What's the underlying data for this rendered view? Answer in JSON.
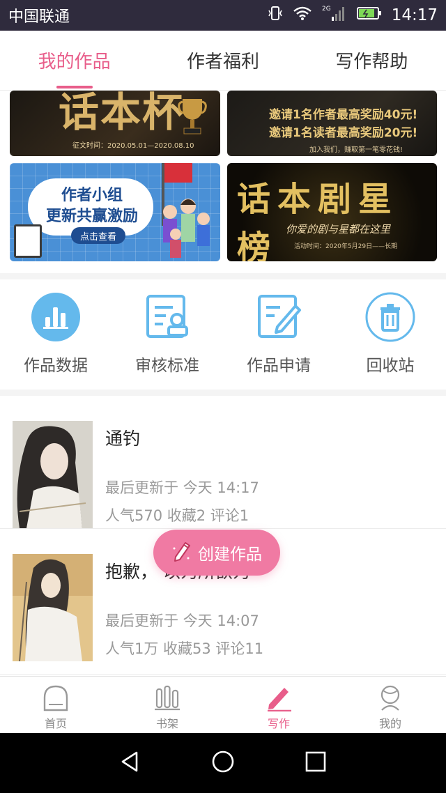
{
  "status_bar": {
    "carrier": "中国联通",
    "network": "2G",
    "time": "14:17"
  },
  "top_tabs": [
    {
      "label": "我的作品",
      "active": true
    },
    {
      "label": "作者福利",
      "active": false
    },
    {
      "label": "写作帮助",
      "active": false
    }
  ],
  "banners": {
    "banner1": {
      "title": "话本杯",
      "subtitle": "征文时间：2020.05.01—2020.08.10"
    },
    "banner2": {
      "line1": "邀请1名作者最高奖励40元!",
      "line2": "邀请1名读者最高奖励20元!",
      "line3": "加入我们，赚取第一笔零花钱!"
    },
    "banner3": {
      "line1": "作者小组",
      "line2": "更新共赢激励",
      "button": "点击查看"
    },
    "banner4": {
      "title": "话本剧星榜",
      "subtitle": "你爱的剧与星都在这里",
      "note": "活动时间：2020年5月29日——长期"
    }
  },
  "tools": [
    {
      "label": "作品数据",
      "icon": "chart-icon"
    },
    {
      "label": "审核标准",
      "icon": "review-standard-icon"
    },
    {
      "label": "作品申请",
      "icon": "edit-apply-icon"
    },
    {
      "label": "回收站",
      "icon": "trash-icon"
    }
  ],
  "works": [
    {
      "title": "通钓",
      "updated": "最后更新于 今天 14:17",
      "stats": "人气570  收藏2  评论1"
    },
    {
      "title": "抱歉，                        以为所欲为",
      "updated": "最后更新于 今天 14:07",
      "stats": "人气1万  收藏53  评论11"
    }
  ],
  "fab": {
    "label": "创建作品"
  },
  "bottom_nav": [
    {
      "label": "首页",
      "active": false
    },
    {
      "label": "书架",
      "active": false
    },
    {
      "label": "写作",
      "active": true
    },
    {
      "label": "我的",
      "active": false
    }
  ],
  "colors": {
    "accent": "#e85d8a",
    "tool_blue": "#4aa6e3",
    "fab": "#f07aa3"
  }
}
